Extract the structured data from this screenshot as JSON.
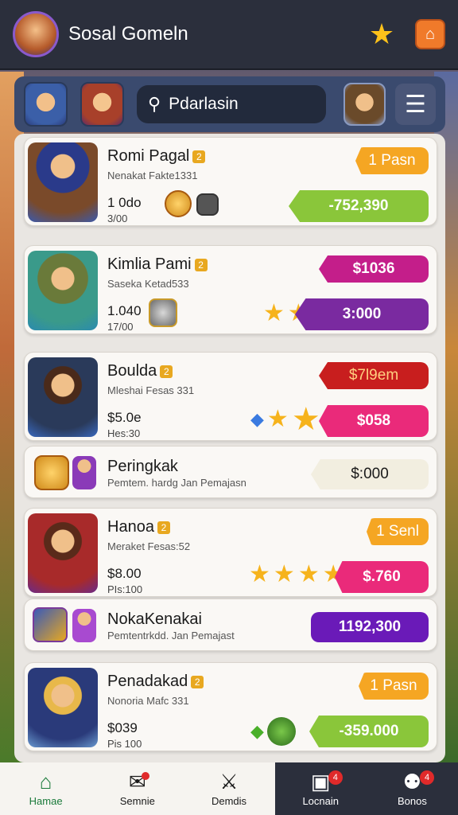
{
  "app": {
    "title": "Sosal Gomeln"
  },
  "search": {
    "value": "Pdarlasin"
  },
  "icons": {
    "search": "search-icon",
    "star": "star-icon",
    "gift": "gift-icon",
    "menu": "hamburger-menu-icon"
  },
  "colors": {
    "topbar": "#2b2f3c",
    "accent_orange": "#f5a623",
    "green": "#8ac63a",
    "magenta": "#c41e8a",
    "purple": "#7a2aa0",
    "red": "#c81e1e",
    "pink": "#ea2a7a",
    "violet": "#6a1ab8"
  },
  "cards": [
    {
      "title": "Romi Pagal",
      "sub": "Nenakat Fakte1331",
      "val": "1 0do",
      "val2": "3/00",
      "chip_top": "1 Pasn",
      "chip_bot": "-752,390"
    },
    {
      "title": "Kimlia Pami",
      "sub": "Saseka Ketad533",
      "val": "1.040",
      "val2": "17/00",
      "chip_top": "$1036",
      "chip_bot": "3:000"
    },
    {
      "title": "Boulda",
      "sub": "Mleshai Fesas 331",
      "val": "$5.0e",
      "val2": "Hes:30",
      "chip_top": "$7l9em",
      "chip_bot": "$058"
    },
    {
      "title": "Peringkak",
      "sub": "Pemtem. hardg Jan Pemajasn",
      "chip_mid": "$:000"
    },
    {
      "title": "Hanoa",
      "sub": "Meraket Fesas:52",
      "val": "$8.00",
      "val2": "PIs:100",
      "chip_top": "1 Senl",
      "chip_bot": "$.760"
    },
    {
      "title": "NokaKenakai",
      "sub": "Pemtentrkdd. Jan Pemajast",
      "chip_mid": "1192,300"
    },
    {
      "title": "Penadakad",
      "sub": "Nonoria Mafc 331",
      "val": "$039",
      "val2": "Pis 100",
      "chip_top": "1 Pasn",
      "chip_bot": "-359.000"
    }
  ],
  "tabs": [
    {
      "label": "Hamae"
    },
    {
      "label": "Semnie"
    },
    {
      "label": "Demdis"
    },
    {
      "label": "Locnain",
      "badge": "4"
    },
    {
      "label": "Bonos",
      "badge": "4"
    }
  ]
}
